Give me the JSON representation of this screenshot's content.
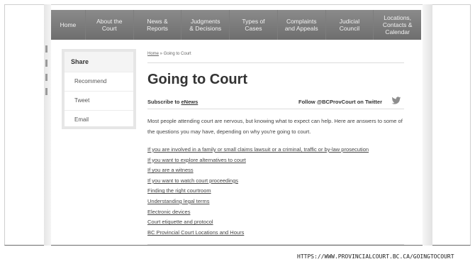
{
  "nav": [
    {
      "label": "Home"
    },
    {
      "label": "About the\nCourt"
    },
    {
      "label": "News &\nReports"
    },
    {
      "label": "Judgments\n& Decisions"
    },
    {
      "label": "Types of\nCases"
    },
    {
      "label": "Complaints\nand Appeals"
    },
    {
      "label": "Judicial\nCouncil"
    },
    {
      "label": "Locations,\nContacts &\nCalendar"
    }
  ],
  "sidebar": {
    "heading": "Share",
    "items": [
      {
        "label": "Recommend"
      },
      {
        "label": "Tweet"
      },
      {
        "label": "Email"
      }
    ]
  },
  "breadcrumb": {
    "home": "Home",
    "separator": " » ",
    "current": "Going to Court"
  },
  "page": {
    "title": "Going to Court",
    "subscribe_prefix": "Subscribe to ",
    "subscribe_link": "eNews",
    "follow": "Follow @BCProvCourt on Twitter",
    "intro": "Most people attending court are nervous, but knowing what to expect can help. Here are answers to some of the questions you may have, depending on why you're going to court."
  },
  "links": [
    {
      "label": "If you are involved in a family or small claims lawsuit or a criminal, traffic or by-law prosecution"
    },
    {
      "label": "If you want to explore alternatives to court"
    },
    {
      "label": "If you are a witness"
    },
    {
      "label": "If you want to watch court proceedings"
    },
    {
      "label": "Finding the right courtroom"
    },
    {
      "label": "Understanding legal terms"
    },
    {
      "label": "Electronic devices"
    },
    {
      "label": "Court etiquette and protocol"
    },
    {
      "label": "BC Provincial Court Locations and Hours"
    }
  ],
  "source_url": "HTTPS://WWW.PROVINCIALCOURT.BC.CA/GOINGTOCOURT",
  "icons": {
    "twitter": "twitter-bird-icon"
  }
}
